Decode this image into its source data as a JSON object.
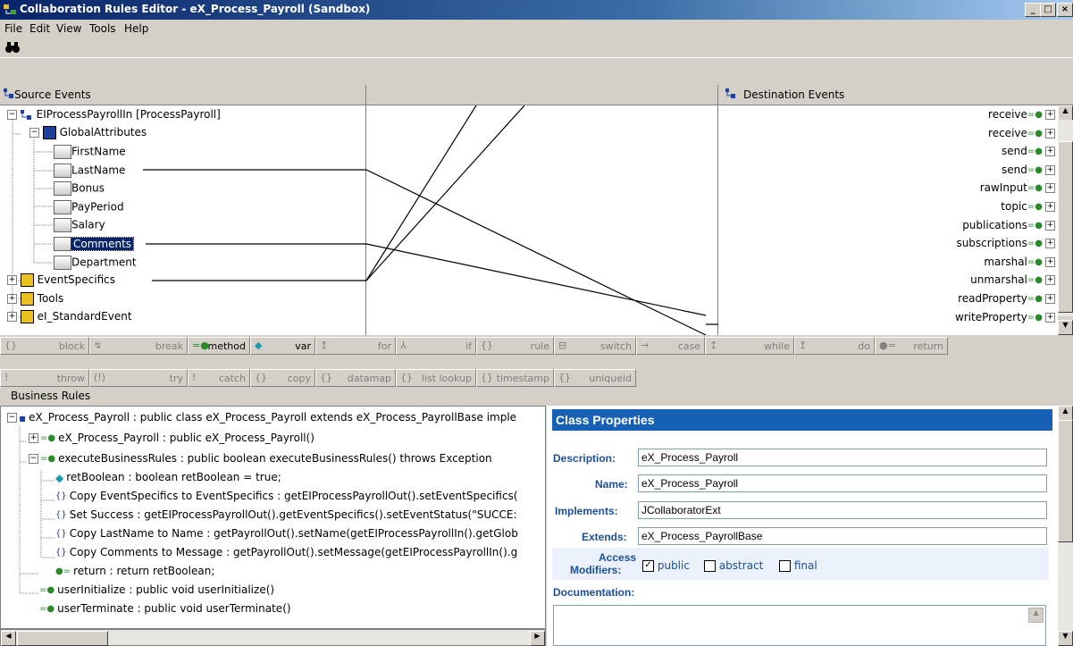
{
  "window": {
    "title": "Collaboration Rules Editor - eX_Process_Payroll (Sandbox)",
    "min": "_",
    "max": "□",
    "close": "×"
  },
  "menu": [
    "File",
    "Edit",
    "View",
    "Tools",
    "Help"
  ],
  "source": {
    "header": "Source Events",
    "items": [
      "EIProcessPayrollIn [ProcessPayroll]",
      "GlobalAttributes",
      "FirstName",
      "LastName",
      "Bonus",
      "PayPeriod",
      "Salary",
      "Comments",
      "Department",
      "EventSpecifics",
      "Tools",
      "eI_StandardEvent"
    ]
  },
  "destination": {
    "header": "Destination Events",
    "items": [
      "receive",
      "receive",
      "send",
      "send",
      "rawInput",
      "topic",
      "publications",
      "subscriptions",
      "marshal",
      "unmarshal",
      "readProperty",
      "writeProperty"
    ]
  },
  "palette": {
    "row1": [
      "block",
      "break",
      "method",
      "var",
      "for",
      "if",
      "rule",
      "switch",
      "case",
      "while",
      "do",
      "return"
    ],
    "row2": [
      "throw",
      "try",
      "catch",
      "copy",
      "datamap",
      "list lookup",
      "timestamp",
      "uniqueid"
    ]
  },
  "rules": {
    "header": "Business Rules",
    "items": [
      "eX_Process_Payroll : public class eX_Process_Payroll extends eX_Process_PayrollBase imple",
      "eX_Process_Payroll : public  eX_Process_Payroll()",
      "executeBusinessRules : public boolean executeBusinessRules() throws Exception",
      "retBoolean : boolean retBoolean = true;",
      "Copy EventSpecifics to EventSpecifics : getEIProcessPayrollOut().setEventSpecifics(",
      "Set Success : getEIProcessPayrollOut().getEventSpecifics().setEventStatus(\"SUCCE:",
      "Copy LastName to Name : getPayrollOut().setName(getEIProcessPayrollIn().getGlob",
      "Copy Comments to Message : getPayrollOut().setMessage(getEIProcessPayrollIn().g",
      "return : return retBoolean;",
      "userInitialize : public void userInitialize()",
      "userTerminate : public void userTerminate()"
    ]
  },
  "props": {
    "title": "Class Properties",
    "description_label": "Description:",
    "description": "eX_Process_Payroll",
    "name_label": "Name:",
    "name": "eX_Process_Payroll",
    "implements_label": "Implements:",
    "implements": "JCollaboratorExt",
    "extends_label": "Extends:",
    "extends": "eX_Process_PayrollBase",
    "access_label1": "Access",
    "access_label2": "Modifiers:",
    "mod_public": "public",
    "mod_abstract": "abstract",
    "mod_final": "final",
    "documentation_label": "Documentation:"
  },
  "colors": {
    "accent": "#1c4f9a",
    "header_blue": "#1660b6",
    "selection": "#0a246a"
  }
}
